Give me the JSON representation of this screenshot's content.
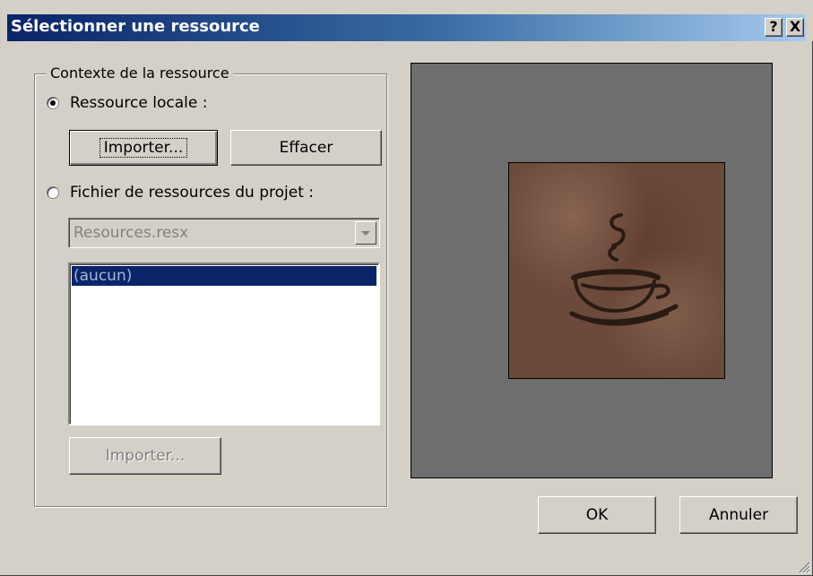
{
  "window": {
    "title": "Sélectionner une ressource",
    "help_button": "?",
    "close_button": "X"
  },
  "resource_context": {
    "group_label": "Contexte de la ressource",
    "local_resource": {
      "label": "Ressource locale :",
      "checked": true,
      "import_button": "Importer...",
      "clear_button": "Effacer"
    },
    "project_resource": {
      "label": "Fichier de ressources du projet :",
      "checked": false,
      "file_select": "Resources.resx",
      "list_items": [
        "(aucun)"
      ],
      "selected_item": "(aucun)",
      "import_button": "Importer..."
    }
  },
  "preview": {
    "image_subject": "coffee-cup-icon",
    "background": "#6e6e6e"
  },
  "footer": {
    "ok_button": "OK",
    "cancel_button": "Annuler"
  },
  "colors": {
    "title_bar": "#0a246a",
    "selection": "#0a246a",
    "face": "#d4d0c8"
  }
}
